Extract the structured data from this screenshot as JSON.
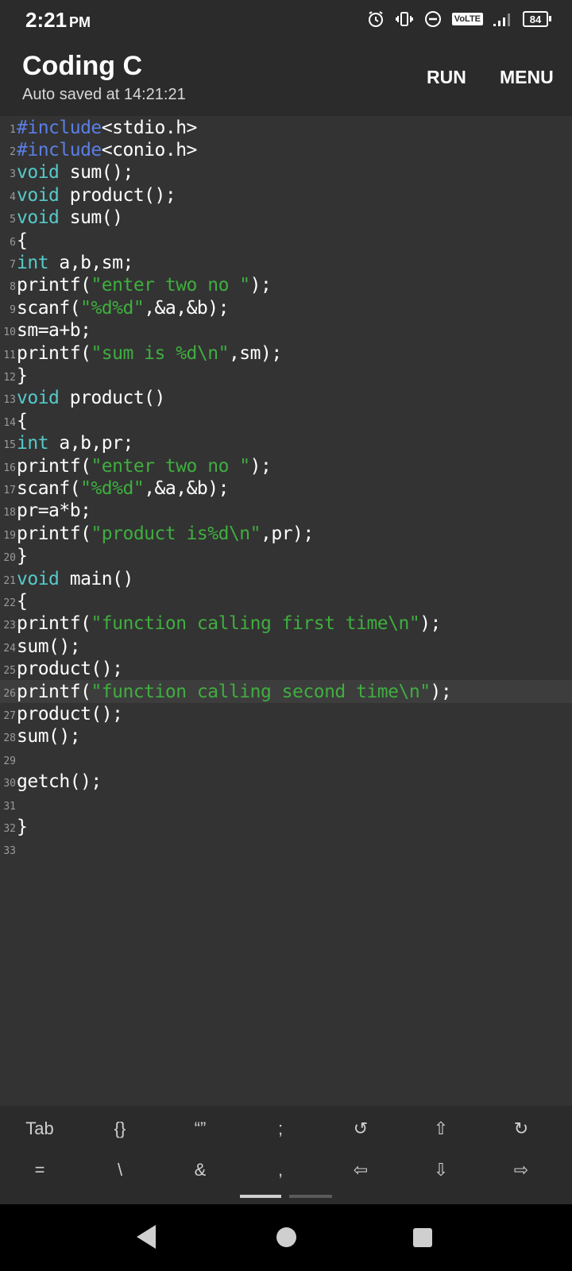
{
  "status_bar": {
    "time": "2:21",
    "ampm": "PM",
    "volte": "VoLTE",
    "battery": "84",
    "icons": [
      "alarm-icon",
      "vibrate-icon",
      "dnd-icon",
      "volte-icon",
      "signal-icon",
      "battery-icon"
    ]
  },
  "app_bar": {
    "title": "Coding C",
    "subtitle": "Auto saved at 14:21:21",
    "run_label": "RUN",
    "menu_label": "MENU"
  },
  "editor": {
    "active_line": 26,
    "lines": [
      {
        "num": "1",
        "tokens": [
          {
            "t": "#include",
            "c": "pp"
          },
          {
            "t": "<stdio.h>",
            "c": "plain"
          }
        ]
      },
      {
        "num": "2",
        "tokens": [
          {
            "t": "#include",
            "c": "pp"
          },
          {
            "t": "<conio.h>",
            "c": "plain"
          }
        ]
      },
      {
        "num": "3",
        "tokens": [
          {
            "t": "void",
            "c": "kw"
          },
          {
            "t": " sum();",
            "c": "plain"
          }
        ]
      },
      {
        "num": "4",
        "tokens": [
          {
            "t": "void",
            "c": "kw"
          },
          {
            "t": " product();",
            "c": "plain"
          }
        ]
      },
      {
        "num": "5",
        "tokens": [
          {
            "t": "void",
            "c": "kw"
          },
          {
            "t": " sum()",
            "c": "plain"
          }
        ]
      },
      {
        "num": "6",
        "tokens": [
          {
            "t": "{",
            "c": "plain"
          }
        ]
      },
      {
        "num": "7",
        "tokens": [
          {
            "t": "int",
            "c": "kw"
          },
          {
            "t": " a,b,sm;",
            "c": "plain"
          }
        ]
      },
      {
        "num": "8",
        "tokens": [
          {
            "t": "printf(",
            "c": "plain"
          },
          {
            "t": "\"enter two no \"",
            "c": "str"
          },
          {
            "t": ");",
            "c": "plain"
          }
        ]
      },
      {
        "num": "9",
        "tokens": [
          {
            "t": "scanf(",
            "c": "plain"
          },
          {
            "t": "\"%d%d\"",
            "c": "str"
          },
          {
            "t": ",&a,&b);",
            "c": "plain"
          }
        ]
      },
      {
        "num": "10",
        "tokens": [
          {
            "t": "sm=a+b;",
            "c": "plain"
          }
        ]
      },
      {
        "num": "11",
        "tokens": [
          {
            "t": "printf(",
            "c": "plain"
          },
          {
            "t": "\"sum is %d\\n\"",
            "c": "str"
          },
          {
            "t": ",sm);",
            "c": "plain"
          }
        ]
      },
      {
        "num": "12",
        "tokens": [
          {
            "t": "}",
            "c": "plain"
          }
        ]
      },
      {
        "num": "13",
        "tokens": [
          {
            "t": "void",
            "c": "kw"
          },
          {
            "t": " product()",
            "c": "plain"
          }
        ]
      },
      {
        "num": "14",
        "tokens": [
          {
            "t": "{",
            "c": "plain"
          }
        ]
      },
      {
        "num": "15",
        "tokens": [
          {
            "t": "int",
            "c": "kw"
          },
          {
            "t": " a,b,pr;",
            "c": "plain"
          }
        ]
      },
      {
        "num": "16",
        "tokens": [
          {
            "t": "printf(",
            "c": "plain"
          },
          {
            "t": "\"enter two no \"",
            "c": "str"
          },
          {
            "t": ");",
            "c": "plain"
          }
        ]
      },
      {
        "num": "17",
        "tokens": [
          {
            "t": "scanf(",
            "c": "plain"
          },
          {
            "t": "\"%d%d\"",
            "c": "str"
          },
          {
            "t": ",&a,&b);",
            "c": "plain"
          }
        ]
      },
      {
        "num": "18",
        "tokens": [
          {
            "t": "pr=a*b;",
            "c": "plain"
          }
        ]
      },
      {
        "num": "19",
        "tokens": [
          {
            "t": "printf(",
            "c": "plain"
          },
          {
            "t": "\"product is%d\\n\"",
            "c": "str"
          },
          {
            "t": ",pr);",
            "c": "plain"
          }
        ]
      },
      {
        "num": "20",
        "tokens": [
          {
            "t": "}",
            "c": "plain"
          }
        ]
      },
      {
        "num": "21",
        "tokens": [
          {
            "t": "void",
            "c": "kw"
          },
          {
            "t": " main()",
            "c": "plain"
          }
        ]
      },
      {
        "num": "22",
        "tokens": [
          {
            "t": "{",
            "c": "plain"
          }
        ]
      },
      {
        "num": "23",
        "tokens": [
          {
            "t": "printf(",
            "c": "plain"
          },
          {
            "t": "\"function calling first time\\n\"",
            "c": "str"
          },
          {
            "t": ");",
            "c": "plain"
          }
        ]
      },
      {
        "num": "24",
        "tokens": [
          {
            "t": "sum();",
            "c": "plain"
          }
        ]
      },
      {
        "num": "25",
        "tokens": [
          {
            "t": "product();",
            "c": "plain"
          }
        ]
      },
      {
        "num": "26",
        "tokens": [
          {
            "t": "printf(",
            "c": "plain"
          },
          {
            "t": "\"function calling second time\\n\"",
            "c": "str"
          },
          {
            "t": ");",
            "c": "plain"
          }
        ]
      },
      {
        "num": "27",
        "tokens": [
          {
            "t": "product();",
            "c": "plain"
          }
        ]
      },
      {
        "num": "28",
        "tokens": [
          {
            "t": "sum();",
            "c": "plain"
          }
        ]
      },
      {
        "num": "29",
        "tokens": []
      },
      {
        "num": "30",
        "tokens": [
          {
            "t": "getch();",
            "c": "plain"
          }
        ]
      },
      {
        "num": "31",
        "tokens": []
      },
      {
        "num": "32",
        "tokens": [
          {
            "t": "}",
            "c": "plain"
          }
        ]
      },
      {
        "num": "33",
        "tokens": []
      }
    ]
  },
  "symbol_bar": {
    "row1": [
      "Tab",
      "{}",
      "“”",
      ";",
      "↺",
      "⇧",
      "↻"
    ],
    "row2": [
      "=",
      "\\",
      "&",
      ",",
      "⇦",
      "⇩",
      "⇨"
    ],
    "names1": [
      "tab-key",
      "braces-key",
      "quotes-key",
      "semicolon-key",
      "undo-icon",
      "cursor-up-icon",
      "redo-icon"
    ],
    "names2": [
      "equals-key",
      "backslash-key",
      "ampersand-key",
      "comma-key",
      "cursor-left-icon",
      "cursor-down-icon",
      "cursor-right-icon"
    ]
  },
  "nav_bar": {
    "icons": [
      "back-icon",
      "home-icon",
      "recents-icon"
    ]
  }
}
